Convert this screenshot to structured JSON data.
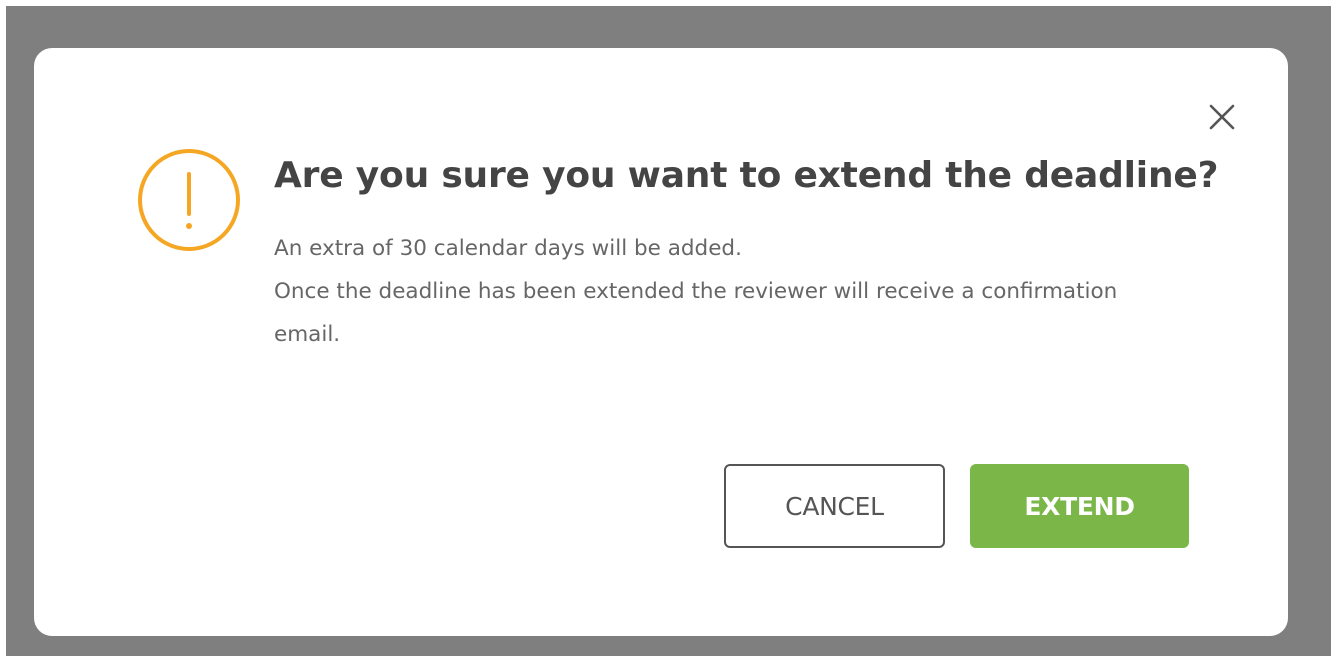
{
  "dialog": {
    "title": "Are you sure you want to extend the deadline?",
    "message_lines": [
      "An extra of 30 calendar days will be added.",
      "Once the deadline has been extended the reviewer will receive a confirmation email."
    ],
    "icons": {
      "close": "close-icon",
      "warning": "warning-exclamation-icon"
    },
    "buttons": {
      "cancel_label": "CANCEL",
      "extend_label": "EXTEND"
    },
    "colors": {
      "warning_accent": "#f5a623",
      "extend_button": "#7ab648",
      "overlay": "#7f7f7f"
    }
  }
}
